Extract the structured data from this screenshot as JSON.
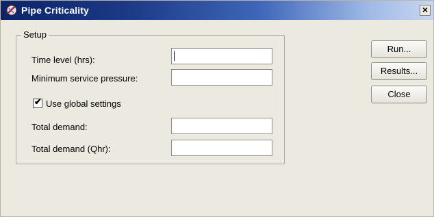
{
  "window": {
    "title": "Pipe Criticality",
    "close_label": "×"
  },
  "setup": {
    "legend": "Setup",
    "fields": [
      {
        "label": "Time level (hrs):",
        "value": ""
      },
      {
        "label": "Minimum service pressure:",
        "value": ""
      },
      {
        "label": "Total demand:",
        "value": ""
      },
      {
        "label": "Total demand (Qhr):",
        "value": ""
      }
    ],
    "global_settings": {
      "label": "Use global settings",
      "checked": true,
      "check_glyph": "✔"
    }
  },
  "buttons": {
    "run": "Run...",
    "results": "Results...",
    "close": "Close"
  }
}
